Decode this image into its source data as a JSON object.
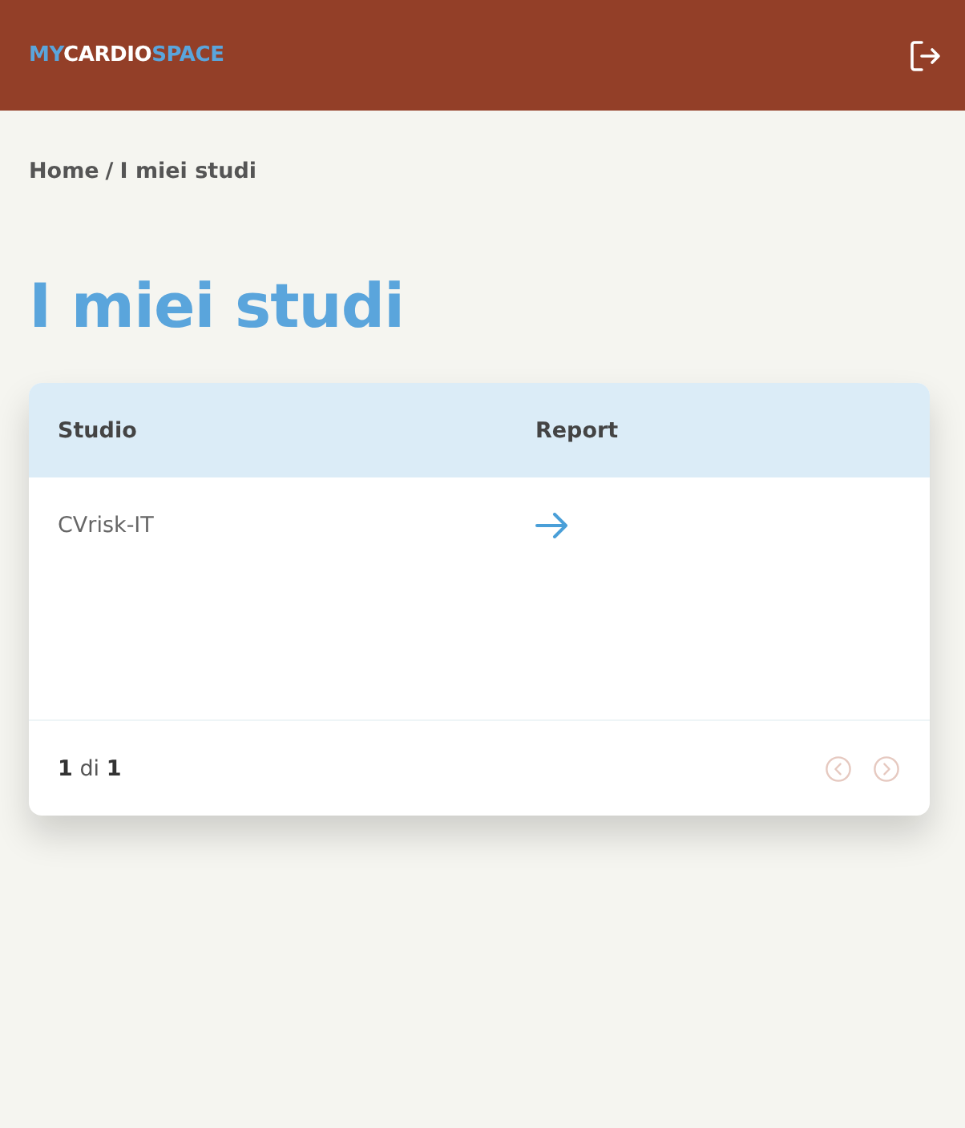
{
  "header": {
    "logo": [
      {
        "text": "MY",
        "kind": "accent"
      },
      {
        "text": "CARDIO",
        "kind": "plain"
      },
      {
        "text": "SPACE",
        "kind": "accent"
      }
    ]
  },
  "breadcrumb": {
    "items": [
      {
        "label": "Home"
      },
      {
        "label": "I miei studi"
      }
    ],
    "separator": "/"
  },
  "title": "I miei studi",
  "table": {
    "columns": [
      "Studio",
      "Report"
    ],
    "rows": [
      {
        "studio": "CVrisk-IT"
      }
    ]
  },
  "pagination": {
    "text": "**1** di **1**",
    "buttons": [
      {
        "kind": "prev",
        "disabled": true
      },
      {
        "kind": "next",
        "disabled": true
      }
    ]
  }
}
